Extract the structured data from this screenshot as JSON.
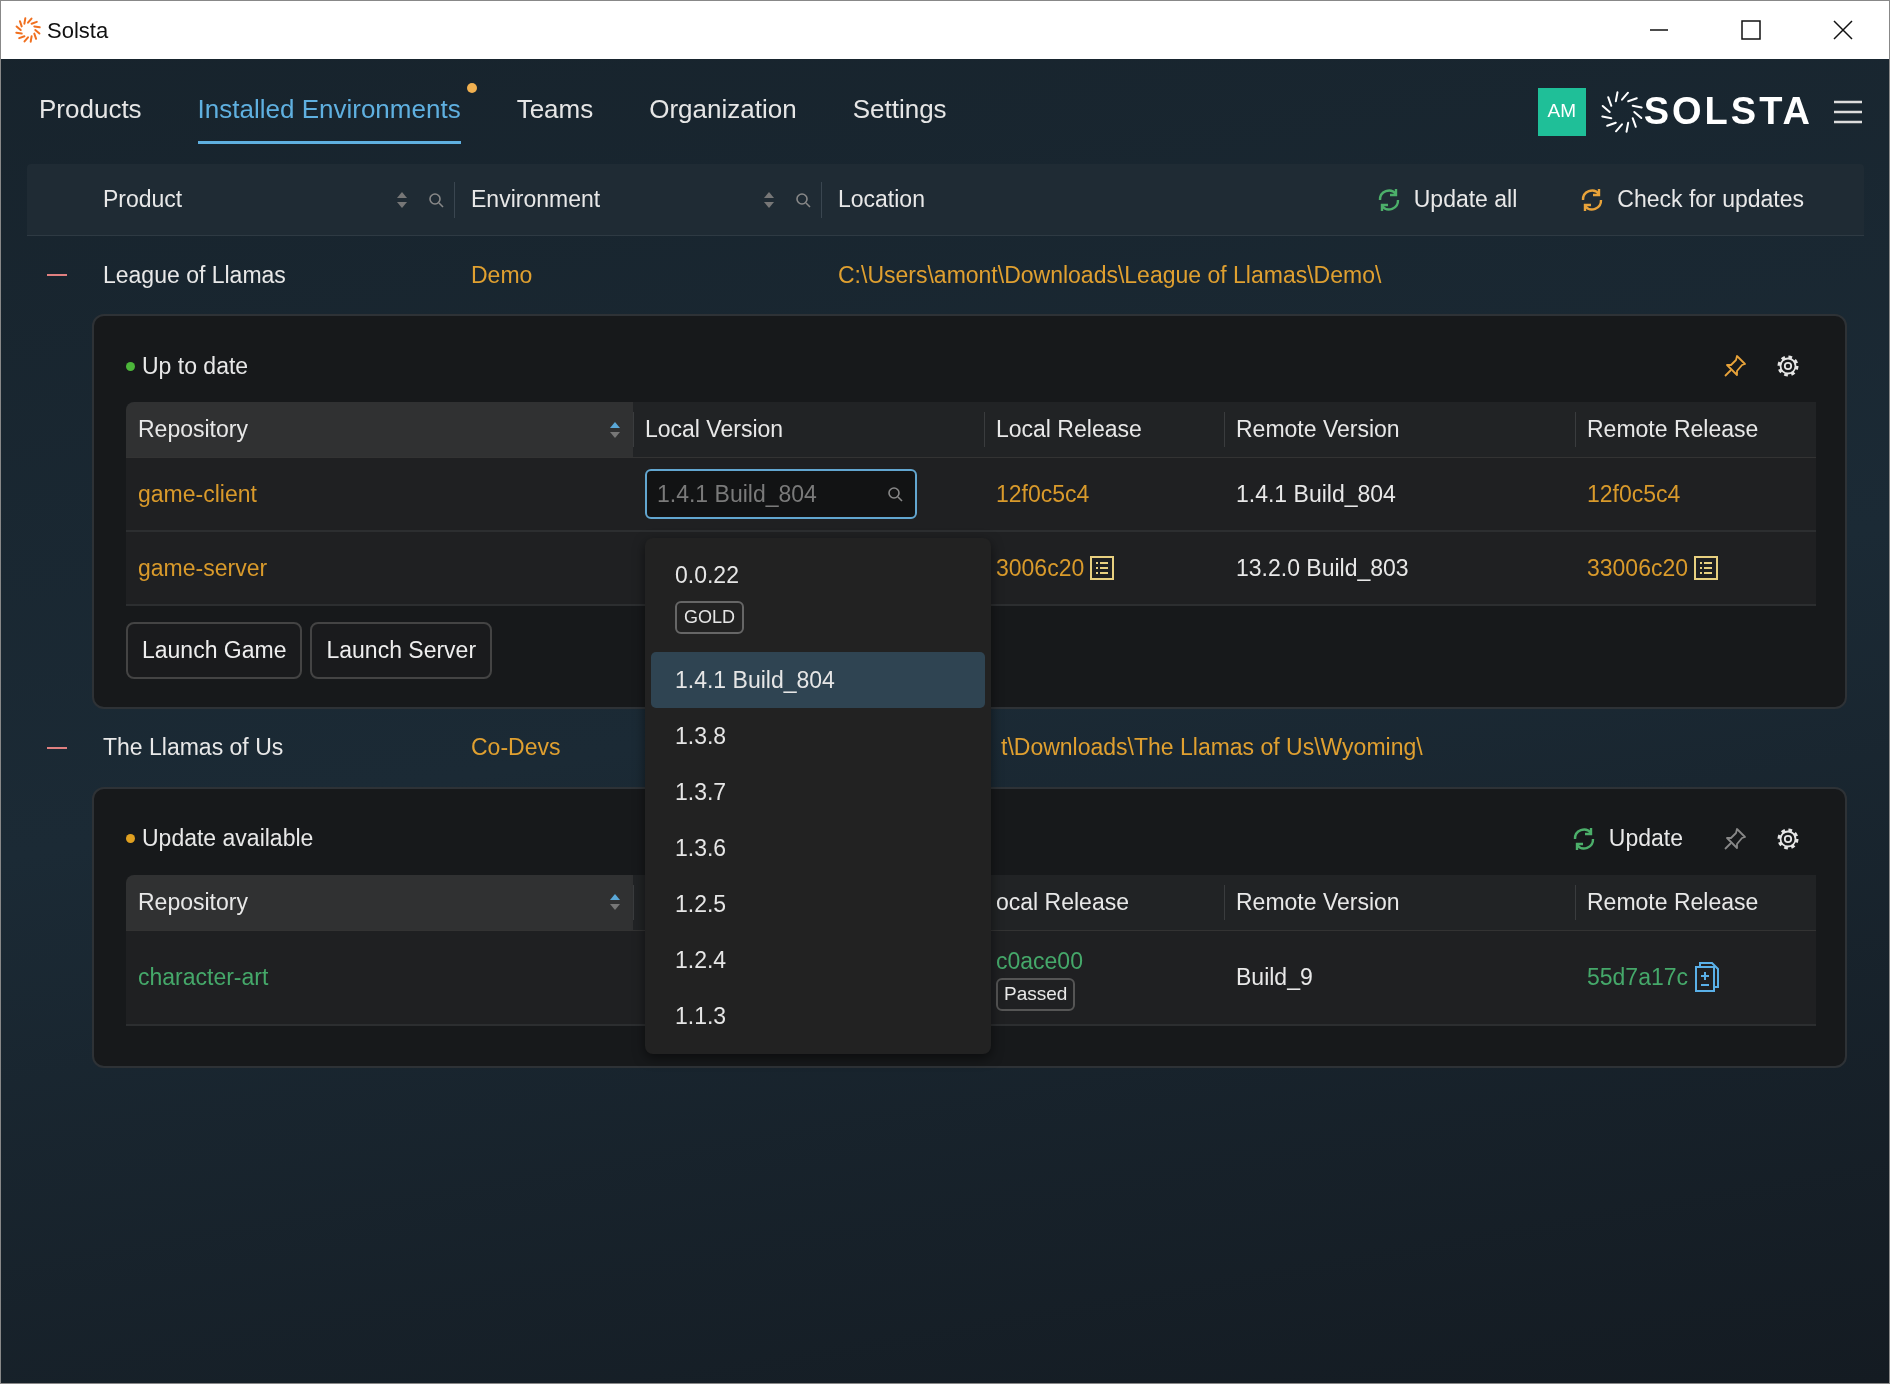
{
  "window": {
    "title": "Solsta"
  },
  "nav": {
    "tabs": [
      {
        "label": "Products",
        "selected": false,
        "notify": false
      },
      {
        "label": "Installed Environments",
        "selected": true,
        "notify": true
      },
      {
        "label": "Teams",
        "selected": false,
        "notify": false
      },
      {
        "label": "Organization",
        "selected": false,
        "notify": false
      },
      {
        "label": "Settings",
        "selected": false,
        "notify": false
      }
    ],
    "avatar": "AM",
    "logo": "SOLSTA"
  },
  "header": {
    "columns": [
      "Product",
      "Environment",
      "Location"
    ],
    "actions": [
      {
        "label": "Update all",
        "color": "#4caf6a"
      },
      {
        "label": "Check for updates",
        "color": "#e8a33a"
      }
    ]
  },
  "groups": [
    {
      "product": "League of Llamas",
      "environment": "Demo",
      "location": "C:\\Users\\amont\\Downloads\\League of Llamas\\Demo\\",
      "covered": false,
      "status": {
        "label": "Up to date",
        "color": "#4cb63a"
      },
      "pinned": true,
      "table": {
        "columns": [
          {
            "label": "Repository",
            "sortable": true
          },
          {
            "label": "Local Version"
          },
          {
            "label": "Local Release"
          },
          {
            "label": "Remote Version"
          },
          {
            "label": "Remote Release"
          }
        ],
        "rows": [
          {
            "repository": "game-client",
            "color": "#d99a2b",
            "version_field": {
              "placeholder": "1.4.1 Build_804"
            },
            "local_release": "12f0c5c4",
            "remote_version": "1.4.1 Build_804",
            "remote_release": "12f0c5c4",
            "dropdown": {
              "items": [
                {
                  "label": "0.0.22",
                  "tag": "GOLD",
                  "selected": false
                },
                {
                  "label": "1.4.1 Build_804",
                  "selected": true
                },
                {
                  "label": "1.3.8",
                  "selected": false
                },
                {
                  "label": "1.3.7",
                  "selected": false
                },
                {
                  "label": "1.3.6",
                  "selected": false
                },
                {
                  "label": "1.2.5",
                  "selected": false
                },
                {
                  "label": "1.2.4",
                  "selected": false
                },
                {
                  "label": "1.1.3",
                  "selected": false
                }
              ]
            }
          },
          {
            "repository": "game-server",
            "color": "#d99a2b",
            "local_release": "3006c20",
            "local_release_notes": true,
            "remote_version": "13.2.0 Build_803",
            "remote_release": "33006c20",
            "remote_release_notes": true
          }
        ]
      },
      "buttons": [
        "Launch Game",
        "Launch Server"
      ]
    },
    {
      "product": "The Llamas of Us",
      "environment": "Co-Devs",
      "location": "t\\Downloads\\The Llamas of Us\\Wyoming\\",
      "covered": true,
      "status": {
        "label": "Update available",
        "color": "#e0a020"
      },
      "update_label": "Update",
      "pinned": false,
      "table": {
        "columns": [
          {
            "label": "Repository",
            "sortable": true
          },
          {
            "covered": true
          },
          {
            "label": "ocal Release"
          },
          {
            "label": "Remote Version"
          },
          {
            "label": "Remote Release"
          }
        ],
        "rows": [
          {
            "repository": "character-art",
            "color": "#45a86a",
            "local_release": "c0ace00",
            "local_release_badge": "Passed",
            "remote_version": "Build_9",
            "remote_release": "55d7a17c",
            "remote_release_diff": true
          }
        ]
      }
    }
  ]
}
